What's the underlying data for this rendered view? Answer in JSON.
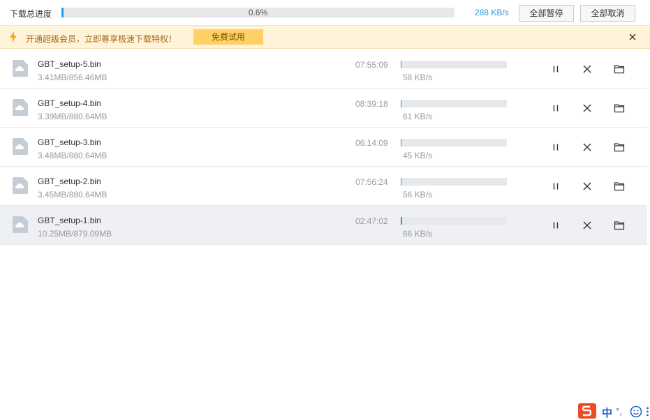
{
  "header": {
    "total_label": "下载总进度",
    "total_progress_fraction": 0.006,
    "total_percent_text": "0.6%",
    "total_speed": "288 KB/s",
    "pause_all_label": "全部暂停",
    "cancel_all_label": "全部取消"
  },
  "banner": {
    "text": "开通超级会员，立即尊享极速下载特权！",
    "trial_label": "免费试用",
    "icon": "lightning-icon"
  },
  "downloads": [
    {
      "name": "GBT_setup-5.bin",
      "size": "3.41MB/856.46MB",
      "time_left": "07:55:09",
      "speed": "58 KB/s",
      "progress_fraction": 0.004,
      "selected": false
    },
    {
      "name": "GBT_setup-4.bin",
      "size": "3.39MB/880.64MB",
      "time_left": "08:39:18",
      "speed": "61 KB/s",
      "progress_fraction": 0.004,
      "selected": false
    },
    {
      "name": "GBT_setup-3.bin",
      "size": "3.48MB/880.64MB",
      "time_left": "06:14:09",
      "speed": "45 KB/s",
      "progress_fraction": 0.004,
      "selected": false
    },
    {
      "name": "GBT_setup-2.bin",
      "size": "3.45MB/880.64MB",
      "time_left": "07:56:24",
      "speed": "56 KB/s",
      "progress_fraction": 0.004,
      "selected": false
    },
    {
      "name": "GBT_setup-1.bin",
      "size": "10.25MB/879.09MB",
      "time_left": "02:47:02",
      "speed": "66 KB/s",
      "progress_fraction": 0.012,
      "selected": true
    }
  ],
  "ime": {
    "mode": "中",
    "punct": "°,",
    "icons": [
      "sogou-logo-icon",
      "emoji-icon",
      "more-icon"
    ]
  },
  "colors": {
    "accent": "#1a9bf0",
    "banner_bg": "#fff3d9",
    "banner_button": "#ffd165",
    "speed_text": "#2f9ad8"
  }
}
